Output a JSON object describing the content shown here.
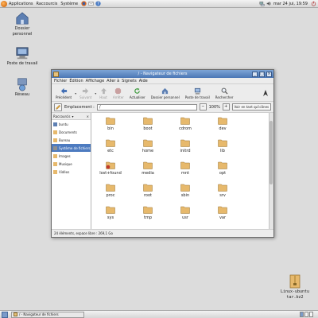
{
  "top_panel": {
    "menus": [
      "Applications",
      "Raccourcis",
      "Système"
    ],
    "clock": "mar 24 jui, 19:59"
  },
  "desktop": {
    "icons": [
      {
        "name": "home",
        "label_line1": "Dossier",
        "label_line2": "personnel"
      },
      {
        "name": "computer",
        "label_line1": "Poste de travail",
        "label_line2": ""
      },
      {
        "name": "network",
        "label_line1": "Réseau",
        "label_line2": ""
      }
    ],
    "file_icon": {
      "label_line1": "Linux-ubuntu",
      "label_line2": "tar.bz2"
    }
  },
  "window": {
    "title": "/ - Navigateur de fichiers",
    "menu": [
      "Fichier",
      "Édition",
      "Affichage",
      "Aller à",
      "Signets",
      "Aide"
    ],
    "toolbar": {
      "back": "Précédent",
      "forward": "Suivant",
      "up": "Haut",
      "stop": "Arrêter",
      "reload": "Actualiser",
      "home": "Dossier personnel",
      "computer": "Poste de travail",
      "search": "Rechercher"
    },
    "location": {
      "label": "Emplacement :",
      "value": "/",
      "zoom": "100%",
      "view": "Voir en tant qu'icônes"
    },
    "sidebar": {
      "header": "Raccourcis",
      "items": [
        "buntu",
        "Documents",
        "Bureau",
        "Système de fichiers",
        "Images",
        "Musique",
        "Vidéos"
      ],
      "selected_index": 3
    },
    "files": [
      "bin",
      "boot",
      "cdrom",
      "dev",
      "etc",
      "home",
      "initrd",
      "lib",
      "lost+found",
      "media",
      "mnt",
      "opt",
      "proc",
      "root",
      "sbin",
      "srv",
      "sys",
      "tmp",
      "usr",
      "var"
    ],
    "status": "24 éléments, espace libre : 269,1 Go"
  },
  "bottom_panel": {
    "task": "/ - Navigateur de fichiers"
  },
  "colors": {
    "titlebar": "#4b77b5",
    "selection": "#4d7bc0",
    "folder": "#e7b96c"
  }
}
